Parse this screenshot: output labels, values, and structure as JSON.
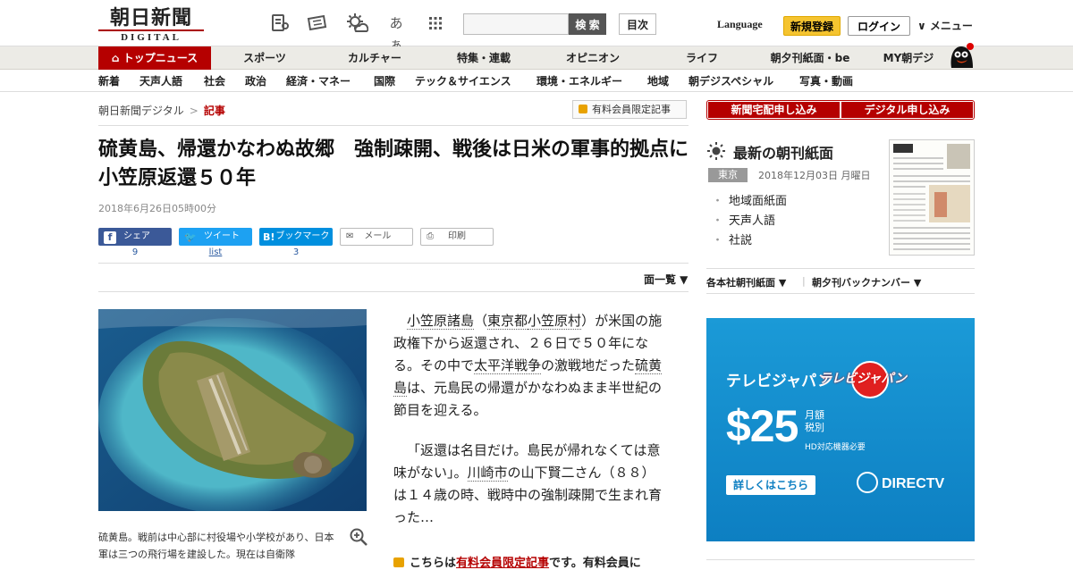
{
  "header": {
    "logo_main": "朝日新聞",
    "logo_sub": "DIGITAL",
    "kana_icon": "あぁ",
    "search_placeholder": "",
    "search_button": "検 索",
    "index_button": "目次",
    "language": "Language",
    "register": "新規登録",
    "login": "ログイン",
    "menu": "∨ メニュー"
  },
  "nav1": [
    "トップニュース",
    "スポーツ",
    "カルチャー",
    "特集・連載",
    "オピニオン",
    "ライフ",
    "朝夕刊紙面・be",
    "MY朝デジ"
  ],
  "nav2": [
    "新着",
    "天声人語",
    "社会",
    "政治",
    "経済・マネー",
    "国際",
    "テック＆サイエンス",
    "環境・エネルギー",
    "地域",
    "朝デジスペシャル",
    "写真・動画"
  ],
  "breadcrumb": {
    "home": "朝日新聞デジタル",
    "sep": ">",
    "current": "記事"
  },
  "paid_badge": "有料会員限定記事",
  "article": {
    "title": "硫黄島、帰還かなわぬ故郷　強制疎開、戦後は日米の軍事的拠点に　小笠原返還５０年",
    "date": "2018年6月26日05時00分",
    "share": {
      "facebook": "シェア",
      "facebook_count": "9",
      "twitter": "ツイート",
      "twitter_count": "list",
      "hatena_icon": "B!",
      "hatena": "ブックマーク",
      "hatena_count": "3",
      "mail": "メール",
      "print": "印刷"
    },
    "page_list": "面一覧 ▼",
    "caption": "硫黄島。戦前は中心部に村役場や小学校があり、日本軍は三つの飛行場を建設した。現在は自衛隊",
    "para1": {
      "pre": "",
      "link1": "小笠原諸島",
      "t1": "（",
      "link2": "東京都",
      "t2": "",
      "link3": "小笠原村",
      "t3": "）が米国の施政権下から返還され、２６日で５０年になる。その中で",
      "link4": "太平洋戦争",
      "t4": "の激戦地だった",
      "link5": "硫黄島",
      "t5": "は、元島民の帰還がかなわぬまま半世紀の節目を迎える。"
    },
    "para2": {
      "t1": "「返還は名目だけ。島民が帰れなくては意味がない」。",
      "link1": "川崎市",
      "t2": "の山下賢二さん（８８）は１４歳の時、戦時中の強制疎開で生まれ育った…"
    },
    "cta_pre": "こちらは",
    "cta_link": "有料会員限定記事",
    "cta_post": "です。有料会員に"
  },
  "sidebar": {
    "btn_home": "新聞宅配申し込み",
    "btn_digital": "デジタル申し込み",
    "chokan_title": "最新の朝刊紙面",
    "region": "東京",
    "paper_date": "2018年12月03日 月曜日",
    "links": [
      "地域面紙面",
      "天声人語",
      "社説"
    ],
    "sel1": "各本社朝刊紙面 ▼",
    "sel2": "朝夕刊バックナンバー ▼",
    "ad": {
      "title": "テレビジャパン",
      "badge_text": "テレビジャパン",
      "price": "$25",
      "monthly": "月額",
      "tax": "税別",
      "note": "HD対応機器必要",
      "cta": "詳しくはこちら",
      "brand": "DIRECTV"
    }
  }
}
